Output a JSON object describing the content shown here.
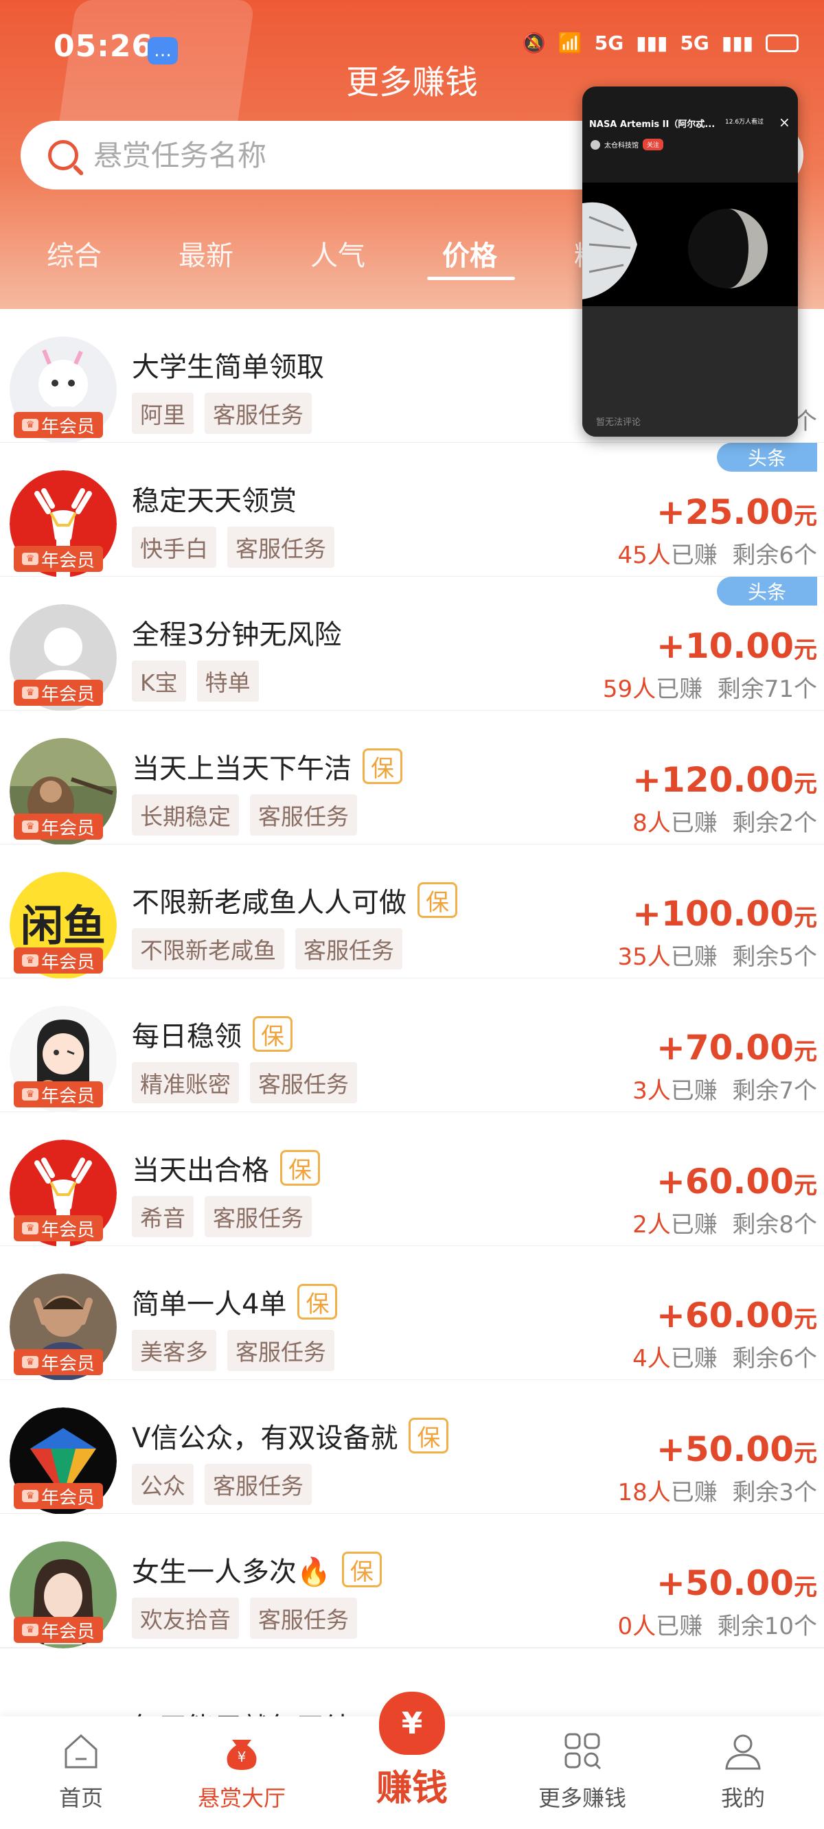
{
  "status": {
    "time": "05:26",
    "signal_1": "5G",
    "signal_2": "5G"
  },
  "header": {
    "title": "更多赚钱"
  },
  "search": {
    "placeholder": "悬赏任务名称"
  },
  "tabs": [
    "综合",
    "最新",
    "人气",
    "价格",
    "精"
  ],
  "active_tab": "价格",
  "vip_label": "年会员",
  "toutiao_label": "头条",
  "tasks": [
    {
      "title": "大学生简单领取",
      "tags": [
        "阿里",
        "客服任务"
      ],
      "bao": false,
      "price": "",
      "earned": "",
      "remaining": "个",
      "avatar": "unicorn"
    },
    {
      "title": "稳定天天领赏",
      "tags": [
        "快手白",
        "客服任务"
      ],
      "bao": false,
      "price": "+25.00",
      "earned": "45人",
      "remaining": "剩余6个",
      "toutiao": true,
      "avatar": "deer"
    },
    {
      "title": "全程3分钟无风险",
      "tags": [
        "K宝",
        "特单"
      ],
      "bao": false,
      "price": "+10.00",
      "earned": "59人",
      "remaining": "剩余71个",
      "toutiao": true,
      "avatar": "default"
    },
    {
      "title": "当天上当天下午洁",
      "tags": [
        "长期稳定",
        "客服任务"
      ],
      "bao": true,
      "price": "+120.00",
      "earned": "8人",
      "remaining": "剩余2个",
      "avatar": "monkey"
    },
    {
      "title": "不限新老咸鱼人人可做",
      "tags": [
        "不限新老咸鱼",
        "客服任务"
      ],
      "bao": true,
      "price": "+100.00",
      "earned": "35人",
      "remaining": "剩余5个",
      "avatar": "xianyu"
    },
    {
      "title": "每日稳领",
      "tags": [
        "精准账密",
        "客服任务"
      ],
      "bao": true,
      "price": "+70.00",
      "earned": "3人",
      "remaining": "剩余7个",
      "avatar": "girl-cartoon"
    },
    {
      "title": "当天出合格",
      "tags": [
        "希音",
        "客服任务"
      ],
      "bao": true,
      "price": "+60.00",
      "earned": "2人",
      "remaining": "剩余8个",
      "avatar": "deer"
    },
    {
      "title": "简单一人4单",
      "tags": [
        "美客多",
        "客服任务"
      ],
      "bao": true,
      "price": "+60.00",
      "earned": "4人",
      "remaining": "剩余6个",
      "avatar": "man"
    },
    {
      "title": "V信公众，有双设备就",
      "tags": [
        "公众",
        "客服任务"
      ],
      "bao": true,
      "price": "+50.00",
      "earned": "18人",
      "remaining": "剩余3个",
      "avatar": "diamond"
    },
    {
      "title": "女生一人多次🔥",
      "tags": [
        "欢友拾音",
        "客服任务"
      ],
      "bao": true,
      "price": "+50.00",
      "earned": "0人",
      "remaining": "剩余10个",
      "avatar": "woman"
    }
  ],
  "earned_suffix": "已赚",
  "yuan": "元",
  "bao_label": "保",
  "partial_row_title": "每天能用就每天结",
  "pip": {
    "title": "NASA Artemis II（阿尔忒...",
    "viewers": "12.6万人看过",
    "channel": "太仓科技馆",
    "follow": "关注",
    "comment": "暂无法评论"
  },
  "bottom_nav": {
    "home": "首页",
    "hall": "悬赏大厅",
    "earn": "赚钱",
    "more": "更多赚钱",
    "mine": "我的"
  },
  "colors": {
    "accent": "#e2492a",
    "header": "#ee5a36",
    "toutiao": "#78b4ee"
  }
}
